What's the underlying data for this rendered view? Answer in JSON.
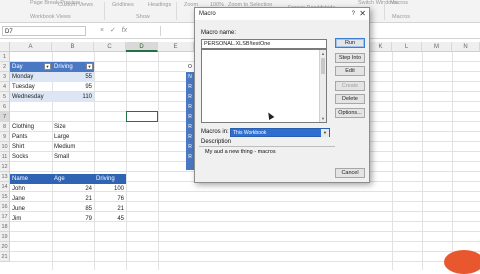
{
  "ribbon": {
    "items": [
      "Page Break Preview",
      "Custom Views",
      "Gridlines",
      "Headings",
      "Zoom",
      "100%",
      "Zoom to Selection",
      "Freeze Panes",
      "Unhide",
      "Switch Windows",
      "Macros"
    ],
    "groups": [
      "Workbook Views",
      "Show",
      "Macros"
    ]
  },
  "formula_bar": {
    "name_box": "D7",
    "icons": [
      "×",
      "✓",
      "fx"
    ]
  },
  "columns": [
    "A",
    "B",
    "C",
    "D",
    "E",
    "F",
    "G",
    "H",
    "I",
    "J",
    "K",
    "L",
    "M",
    "N"
  ],
  "selected_column": "D",
  "rows": [
    "1",
    "2",
    "3",
    "4",
    "5",
    "6",
    "7",
    "8",
    "9",
    "10",
    "11",
    "12",
    "13",
    "14",
    "15",
    "16",
    "17",
    "18",
    "19",
    "20",
    "21"
  ],
  "selected_row": "7",
  "table1": {
    "headers": [
      "Day",
      "Driving"
    ],
    "rows": [
      [
        "Monday",
        "55"
      ],
      [
        "Tuesday",
        "95"
      ],
      [
        "Wednesday",
        "110"
      ]
    ]
  },
  "clothing": [
    [
      "Clothing",
      "Size"
    ],
    [
      "Pants",
      "Large"
    ],
    [
      "Shirt",
      "Medium"
    ],
    [
      "Socks",
      "Small"
    ]
  ],
  "table2": {
    "headers": [
      "Name",
      "Age",
      "Driving"
    ],
    "rows": [
      [
        "John",
        "24",
        "100"
      ],
      [
        "Jane",
        "21",
        "76"
      ],
      [
        "June",
        "85",
        "21"
      ],
      [
        "Jim",
        "79",
        "45"
      ]
    ]
  },
  "partial_column_letters": [
    "O",
    "N",
    "R",
    "R",
    "R",
    "R",
    "R",
    "R",
    "R",
    "R"
  ],
  "dialog": {
    "title": "Macro",
    "help": "?",
    "close": "✕",
    "macro_name_label": "Macro name:",
    "macro_name_value": "PERSONAL.XLSB!testOne",
    "buttons": [
      "Run",
      "Step Into",
      "Edit",
      "Create",
      "Delete",
      "Options..."
    ],
    "macros_in_label": "Macros in:",
    "macros_in_value": "This Workbook",
    "description_label": "Description",
    "description_text": "My aud a new thing - macros",
    "cancel": "Cancel"
  }
}
